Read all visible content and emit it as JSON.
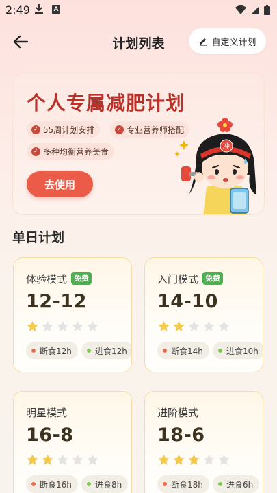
{
  "status": {
    "time": "2:49"
  },
  "header": {
    "title": "计划列表",
    "custom_label": "自定义计划"
  },
  "promo": {
    "title": "个人专属减肥计划",
    "tags": [
      "55周计划安排",
      "专业营养师搭配",
      "多种均衡营养美食"
    ],
    "button": "去使用",
    "mascot_badge": "冲"
  },
  "section": {
    "title": "单日计划"
  },
  "plans": [
    {
      "name": "体验模式",
      "badge": "免费",
      "ratio": "12-12",
      "rating": 1,
      "fast": "断食12h",
      "eat": "进食12h"
    },
    {
      "name": "入门模式",
      "badge": "免费",
      "ratio": "14-10",
      "rating": 2,
      "fast": "断食14h",
      "eat": "进食10h"
    },
    {
      "name": "明星模式",
      "badge": "",
      "ratio": "16-8",
      "rating": 2,
      "fast": "断食16h",
      "eat": "进食8h"
    },
    {
      "name": "进阶模式",
      "badge": "",
      "ratio": "18-6",
      "rating": 3,
      "fast": "断食18h",
      "eat": "进食6h"
    }
  ],
  "colors": {
    "accent": "#ea5b48",
    "title_red": "#b8322a",
    "star_on": "#f2c94c",
    "star_off": "#e3e3e3",
    "fast_dot": "#f06a4a",
    "eat_dot": "#7bc950",
    "badge_green": "#4caf50"
  }
}
